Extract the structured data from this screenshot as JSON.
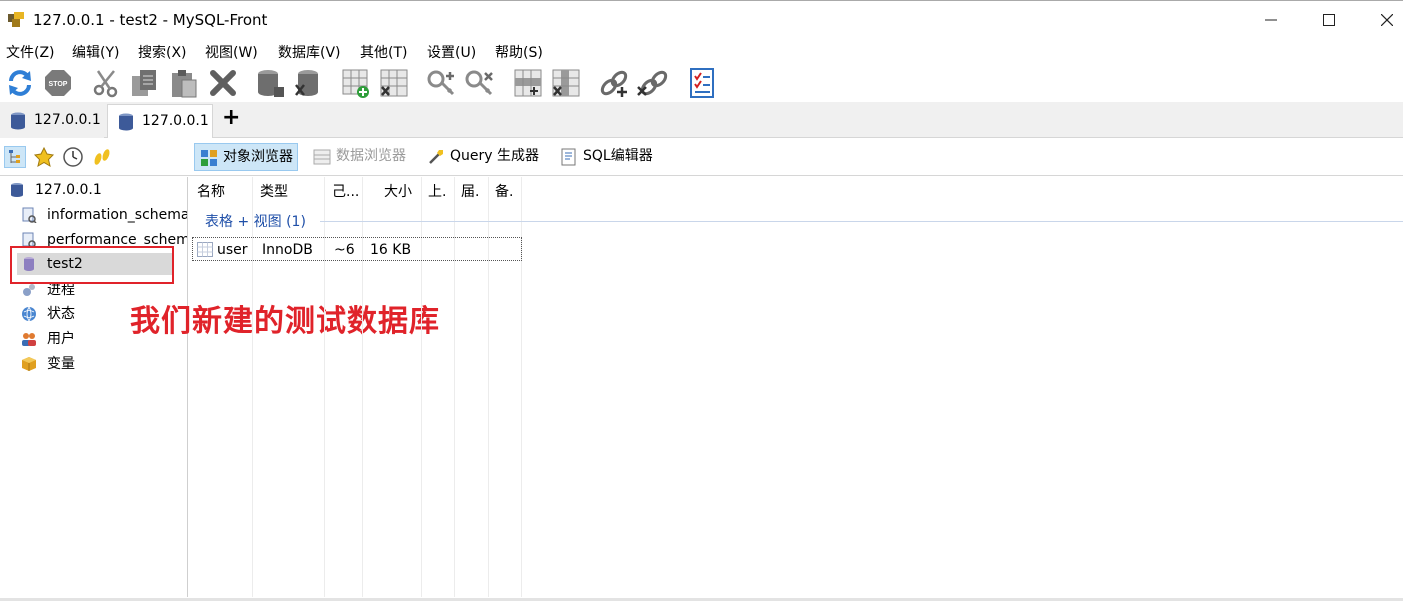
{
  "window": {
    "title": "127.0.0.1 - test2 - MySQL-Front",
    "minimize": "—",
    "maximize": "☐",
    "close": "✕"
  },
  "menu": [
    "文件(Z)",
    "编辑(Y)",
    "搜索(X)",
    "视图(W)",
    "数据库(V)",
    "其他(T)",
    "设置(U)",
    "帮助(S)"
  ],
  "toolbar_icons": [
    "refresh-icon",
    "stop-icon",
    "cut-icon",
    "copy-icon",
    "paste-icon",
    "delete-icon",
    "create-database-icon",
    "drop-database-icon",
    "create-table-icon",
    "drop-table-icon",
    "create-user-icon",
    "drop-user-icon",
    "add-field-icon",
    "drop-field-icon",
    "add-link-icon",
    "remove-link-icon",
    "properties-icon"
  ],
  "tabs": [
    {
      "label": "127.0.0.1",
      "active": false
    },
    {
      "label": "127.0.0.1",
      "active": true
    }
  ],
  "tab_add": "+",
  "views": {
    "object_browser": "对象浏览器",
    "data_browser": "数据浏览器",
    "query_builder": "Query 生成器",
    "sql_editor": "SQL编辑器"
  },
  "tree": {
    "root": "127.0.0.1",
    "items": [
      {
        "label": "information_schema",
        "icon": "database-schema-icon"
      },
      {
        "label": "performance_schema",
        "icon": "database-schema-icon"
      },
      {
        "label": "test2",
        "icon": "database-icon"
      },
      {
        "label": "进程",
        "icon": "process-icon"
      },
      {
        "label": "状态",
        "icon": "status-icon"
      },
      {
        "label": "用户",
        "icon": "users-icon"
      },
      {
        "label": "变量",
        "icon": "variables-icon"
      }
    ]
  },
  "annotation": "我们新建的测试数据库",
  "list": {
    "columns": [
      "名称",
      "类型",
      "己...",
      "大小",
      "上.",
      "届.",
      "备."
    ],
    "group": "表格 + 视图 (1)",
    "rows": [
      {
        "name": "user",
        "type": "InnoDB",
        "rows": "~6",
        "size": "16 KB"
      }
    ]
  },
  "colors": {
    "highlight": "#e0232a",
    "group_text": "#1f4fa8",
    "active_view": "#cde6f7"
  }
}
